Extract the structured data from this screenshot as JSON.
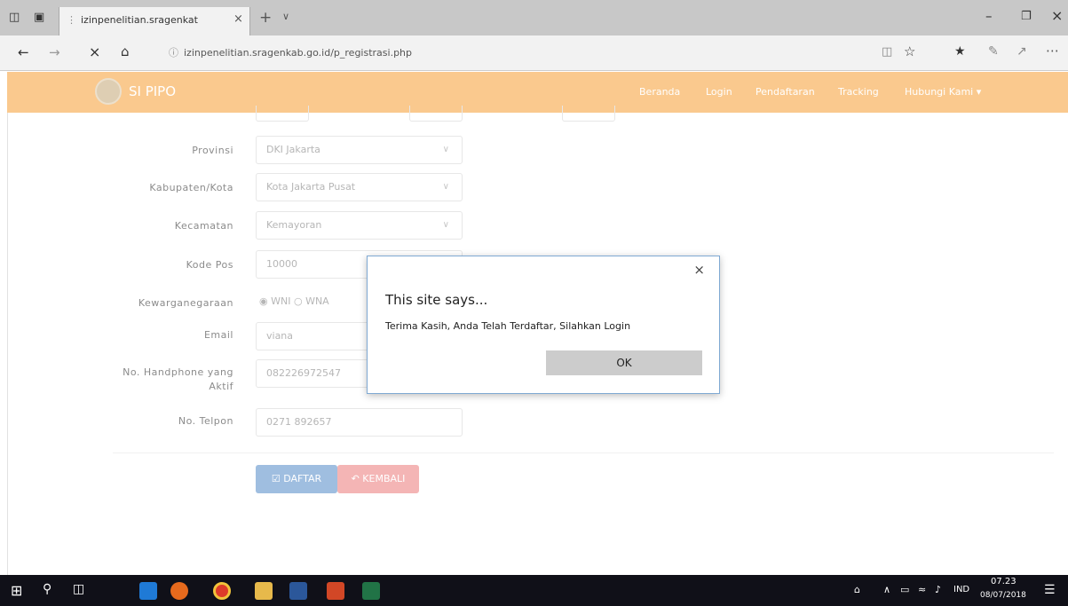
{
  "browser": {
    "tab_title": "izinpenelitian.sragenkat",
    "url": "izinpenelitian.sragenkab.go.id/p_registrasi.php"
  },
  "site": {
    "brand": "SI PIPO",
    "nav": [
      "Beranda",
      "Login",
      "Pendaftaran",
      "Tracking",
      "Hubungi Kami ▾"
    ],
    "header_color": "#f9c07b"
  },
  "form": {
    "provinsi": {
      "label": "Provinsi",
      "value": "DKI Jakarta"
    },
    "kabupaten": {
      "label": "Kabupaten/Kota",
      "value": "Kota Jakarta Pusat"
    },
    "kecamatan": {
      "label": "Kecamatan",
      "value": "Kemayoran"
    },
    "kodepos": {
      "label": "Kode Pos",
      "value": "10000"
    },
    "kewarganegaraan": {
      "label": "Kewarganegaraan",
      "opt1": "WNI",
      "opt2": "WNA"
    },
    "email": {
      "label": "Email",
      "value": "viana"
    },
    "handphone": {
      "label1": "No. Handphone yang",
      "label2": "Aktif",
      "value": "082226972547"
    },
    "telpon": {
      "label": "No. Telpon",
      "value": "0271 892657"
    },
    "daftar_label": "DAFTAR",
    "kembali_label": "KEMBALI"
  },
  "dialog": {
    "title": "This site says...",
    "message": "Terima Kasih, Anda Telah Terdaftar, Silahkan Login",
    "ok_label": "OK",
    "close": "×"
  },
  "taskbar": {
    "lang": "IND",
    "time": "07.23",
    "date": "08/07/2018"
  }
}
